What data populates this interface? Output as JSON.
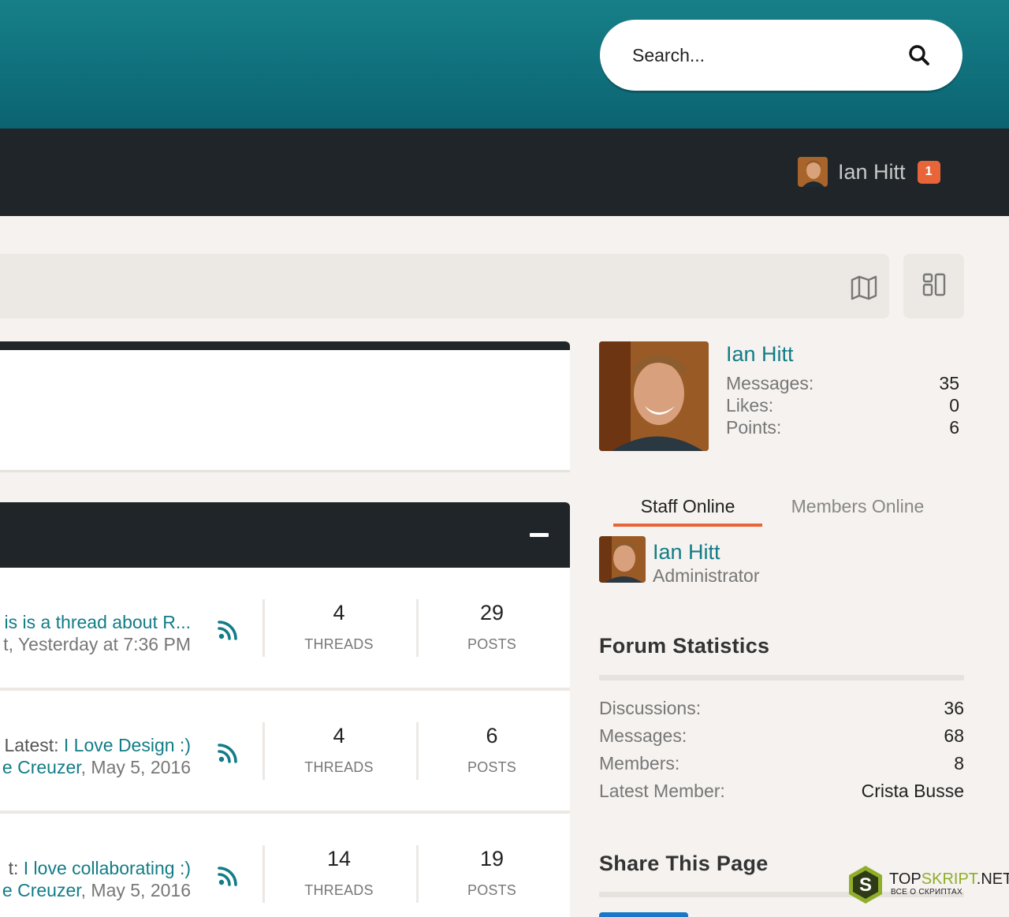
{
  "header": {
    "search_placeholder": "Search..."
  },
  "nav": {
    "username": "Ian Hitt",
    "notification_count": "1"
  },
  "forum_rows": [
    {
      "latest_prefix": "",
      "latest_title": "is is a thread about R...",
      "by_user": "t",
      "date": ", Yesterday at 7:36 PM",
      "threads": "4",
      "threads_label": "THREADS",
      "posts": "29",
      "posts_label": "POSTS"
    },
    {
      "latest_prefix": "Latest: ",
      "latest_title": "I Love Design :)",
      "by_user": "e Creuzer",
      "date": ", May 5, 2016",
      "threads": "4",
      "threads_label": "THREADS",
      "posts": "6",
      "posts_label": "POSTS"
    },
    {
      "latest_prefix": "t: ",
      "latest_title": "I love collaborating :)",
      "by_user": "e Creuzer",
      "date": ", May 5, 2016",
      "threads": "14",
      "threads_label": "THREADS",
      "posts": "19",
      "posts_label": "POSTS"
    }
  ],
  "profile": {
    "name": "Ian Hitt",
    "stats": [
      {
        "label": "Messages:",
        "value": "35"
      },
      {
        "label": "Likes:",
        "value": "0"
      },
      {
        "label": "Points:",
        "value": "6"
      }
    ]
  },
  "online_tabs": {
    "staff": "Staff Online",
    "members": "Members Online"
  },
  "staff_online": {
    "name": "Ian Hitt",
    "role": "Administrator"
  },
  "forum_statistics": {
    "title": "Forum Statistics",
    "rows": [
      {
        "label": "Discussions:",
        "value": "36"
      },
      {
        "label": "Messages:",
        "value": "68"
      },
      {
        "label": "Members:",
        "value": "8"
      },
      {
        "label": "Latest Member:",
        "value": "Crista Busse"
      }
    ]
  },
  "share": {
    "title": "Share This Page"
  },
  "watermark": {
    "brand_a": "TOP",
    "brand_b": "SKRIPT",
    "brand_c": ".NET",
    "tagline": "ВСЕ О СКРИПТАХ",
    "logo_letter": "S"
  },
  "colors": {
    "accent_teal": "#127c87",
    "header_teal": "#137884",
    "dark_bar": "#1f2528",
    "badge_orange": "#e8653a",
    "page_bg": "#f5f2ef"
  },
  "icons": [
    "search-icon",
    "map-icon",
    "layout-grid-icon",
    "minus-icon",
    "rss-icon",
    "avatar-photo"
  ]
}
